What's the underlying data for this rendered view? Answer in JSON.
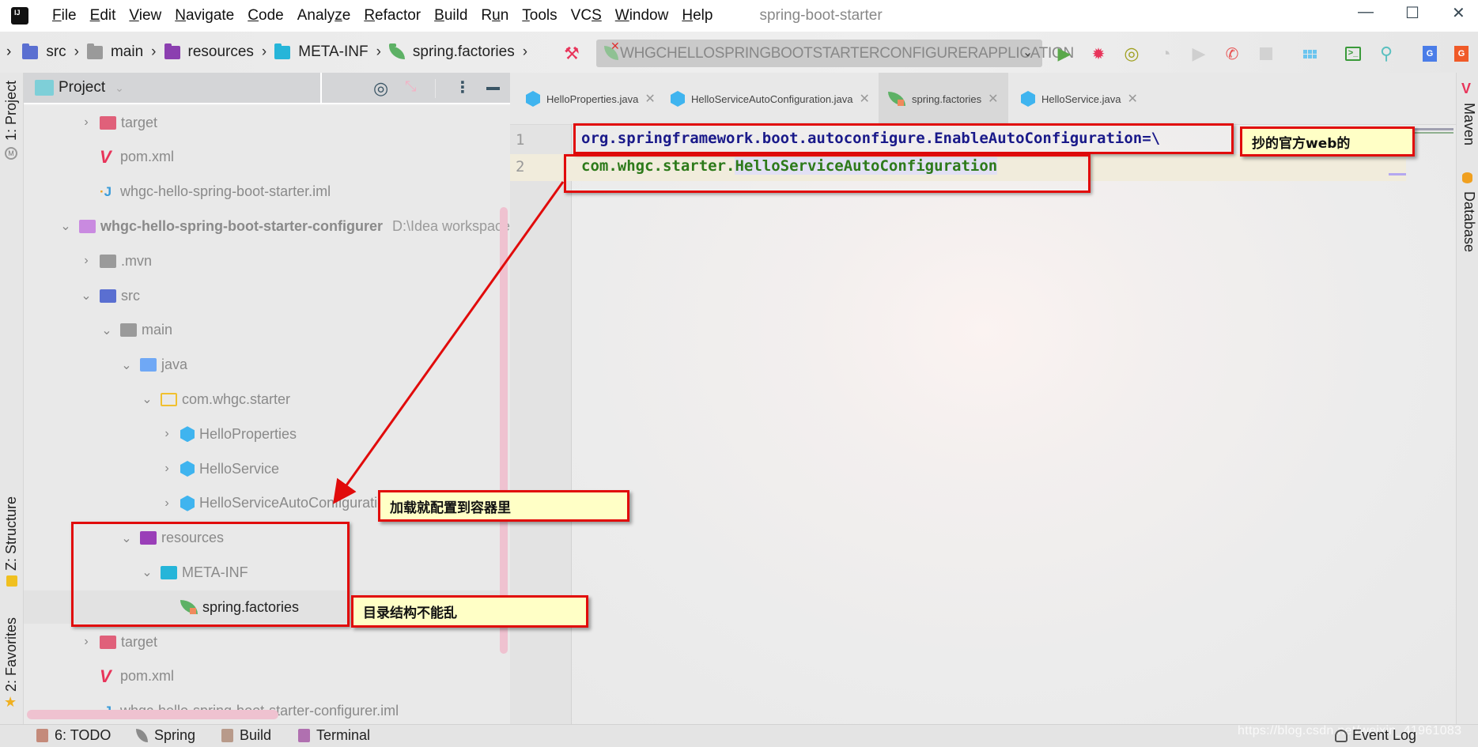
{
  "titlebar": {
    "app_icon": "intellij-logo-icon",
    "menu": [
      "File",
      "Edit",
      "View",
      "Navigate",
      "Code",
      "Analyze",
      "Refactor",
      "Build",
      "Run",
      "Tools",
      "VCS",
      "Window",
      "Help"
    ],
    "menu_mnemonic_index": [
      0,
      0,
      0,
      0,
      0,
      5,
      0,
      0,
      1,
      0,
      2,
      0,
      0
    ],
    "window_title": "spring-boot-starter",
    "controls": {
      "minimize": "—",
      "maximize": "☐",
      "close": "✕"
    }
  },
  "navbar": {
    "breadcrumbs": [
      {
        "label": "src",
        "icon": "source-folder-icon",
        "color": "#5a6fd1"
      },
      {
        "label": "main",
        "icon": "folder-icon",
        "color": "#9a9a9a"
      },
      {
        "label": "resources",
        "icon": "resources-folder-icon",
        "color": "#8b3fb0"
      },
      {
        "label": "META-INF",
        "icon": "meta-inf-folder-icon",
        "color": "#26b5d9"
      },
      {
        "label": "spring.factories",
        "icon": "spring-leaf-icon",
        "color": "#5db165"
      }
    ],
    "run_config": "WHGCHELLOSPRINGBOOTSTARTERCONFIGURERAPPLICATION",
    "toolbar_icons": [
      "build-hammer-icon",
      "run-icon",
      "debug-icon",
      "run-with-coverage-icon",
      "profiler-icon",
      "attach-icon",
      "stop-call-icon",
      "stop-icon",
      "project-structure-icon",
      "terminal-icon",
      "search-icon",
      "google-translate-icon",
      "google-translate-alt-icon"
    ]
  },
  "left_stripe": {
    "tabs": [
      {
        "label": "1: Project"
      },
      {
        "label": "Z: Structure"
      },
      {
        "label": "2: Favorites"
      }
    ]
  },
  "project_panel": {
    "title": "Project",
    "header_icons": [
      "locate-target-icon",
      "collapse-all-icon",
      "more-options-icon",
      "hide-panel-icon"
    ],
    "tree": [
      {
        "label": "target",
        "icon": "excluded-folder-icon",
        "depth": 1,
        "chevron": "right"
      },
      {
        "label": "pom.xml",
        "icon": "maven-icon",
        "depth": 1,
        "chevron": "none"
      },
      {
        "label": "whgc-hello-spring-boot-starter.iml",
        "icon": "iml-icon",
        "depth": 1,
        "chevron": "none"
      },
      {
        "label": "whgc-hello-spring-boot-starter-configurer",
        "suffix": "D:\\Idea workspaces\\sp",
        "icon": "module-folder-icon",
        "depth": 0,
        "chevron": "down",
        "bold": true
      },
      {
        "label": ".mvn",
        "icon": "folder-icon",
        "depth": 1,
        "chevron": "right"
      },
      {
        "label": "src",
        "icon": "source-folder-icon",
        "depth": 1,
        "chevron": "down"
      },
      {
        "label": "main",
        "icon": "folder-icon",
        "depth": 2,
        "chevron": "down"
      },
      {
        "label": "java",
        "icon": "java-source-folder-icon",
        "depth": 3,
        "chevron": "down"
      },
      {
        "label": "com.whgc.starter",
        "icon": "package-icon",
        "depth": 4,
        "chevron": "down"
      },
      {
        "label": "HelloProperties",
        "icon": "class-icon",
        "depth": 5,
        "chevron": "right"
      },
      {
        "label": "HelloService",
        "icon": "class-icon",
        "depth": 5,
        "chevron": "right"
      },
      {
        "label": "HelloServiceAutoConfiguration",
        "icon": "class-icon",
        "depth": 5,
        "chevron": "right"
      },
      {
        "label": "resources",
        "icon": "resources-folder-icon",
        "depth": 3,
        "chevron": "down"
      },
      {
        "label": "META-INF",
        "icon": "meta-inf-folder-icon",
        "depth": 4,
        "chevron": "down"
      },
      {
        "label": "spring.factories",
        "icon": "spring-leaf-icon",
        "depth": 5,
        "chevron": "none",
        "selected": true
      },
      {
        "label": "target",
        "icon": "excluded-folder-icon",
        "depth": 1,
        "chevron": "right"
      },
      {
        "label": "pom.xml",
        "icon": "maven-icon",
        "depth": 1,
        "chevron": "none"
      },
      {
        "label": "whgc-hello-spring-boot-starter-configurer.iml",
        "icon": "iml-icon",
        "depth": 1,
        "chevron": "none"
      }
    ]
  },
  "editor": {
    "tabs": [
      {
        "label": "HelloProperties.java",
        "icon": "class-icon",
        "active": false
      },
      {
        "label": "HelloServiceAutoConfiguration.java",
        "icon": "class-icon",
        "active": false
      },
      {
        "label": "spring.factories",
        "icon": "spring-leaf-icon",
        "active": true
      },
      {
        "label": "HelloService.java",
        "icon": "class-icon",
        "active": false
      }
    ],
    "lines": [
      {
        "number": "1",
        "text": "org.springframework.boot.autoconfigure.EnableAutoConfiguration=\\"
      },
      {
        "number": "2",
        "prefix": "com.whgc.starter.",
        "highlight": "HelloServiceAutoConfiguration"
      }
    ]
  },
  "right_stripe": {
    "tabs": [
      {
        "label": "Maven",
        "icon": "maven-icon"
      },
      {
        "label": "Database",
        "icon": "database-icon"
      }
    ]
  },
  "statusbar": {
    "items": [
      {
        "label": "6: TODO",
        "icon": "todo-icon"
      },
      {
        "label": "Spring",
        "icon": "spring-leaf-icon"
      },
      {
        "label": "Build",
        "icon": "build-icon"
      },
      {
        "label": "Terminal",
        "icon": "terminal-icon"
      }
    ],
    "event_log": "Event Log",
    "watermark": "https://blog.csdn.net/weixin_41961083"
  },
  "annotations": {
    "note1": "抄的官方web的",
    "note2": "加载就配置到容器里",
    "note3": "目录结构不能乱"
  },
  "colors": {
    "annotation_border": "#e10b0b",
    "annotation_fill": "#ffffc6",
    "code_key": "#1a1a8a",
    "code_value": "#2d7a1a"
  }
}
